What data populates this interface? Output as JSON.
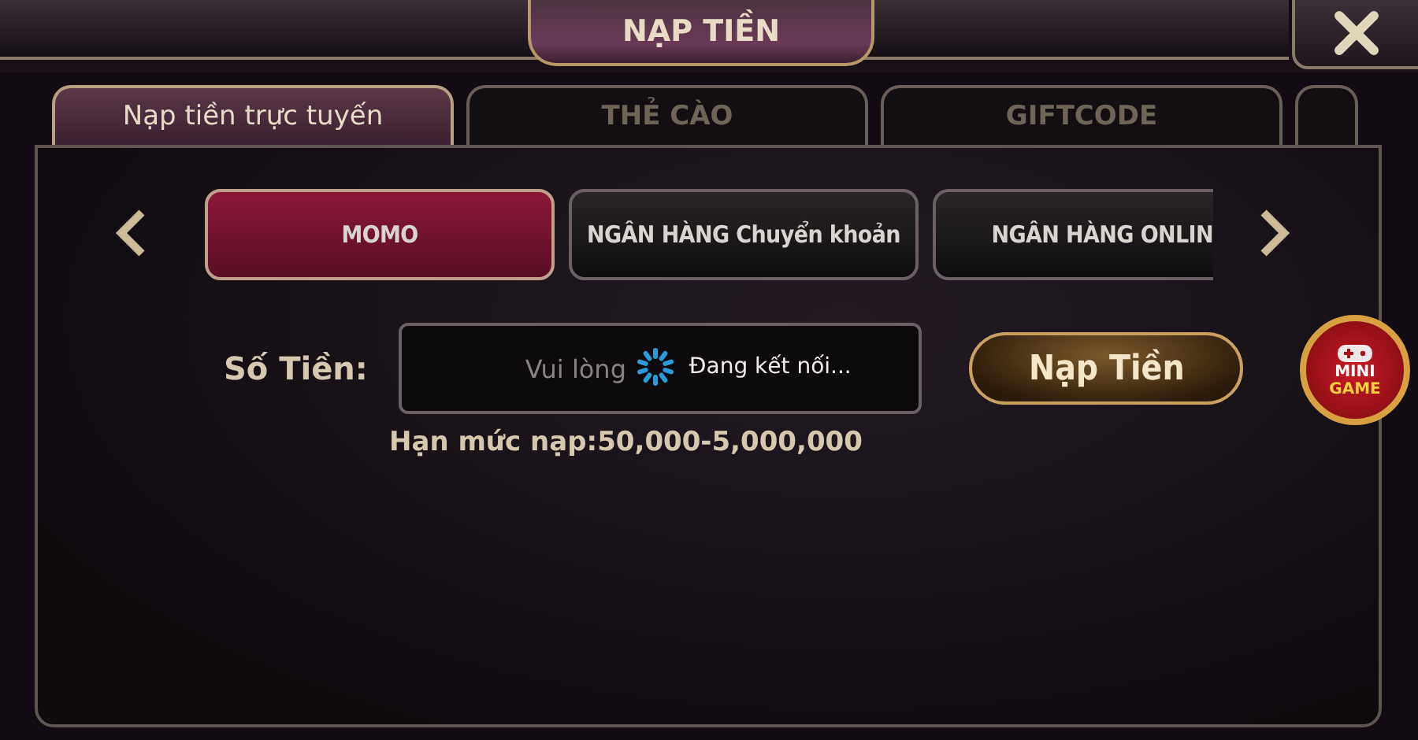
{
  "header": {
    "title": "NẠP TIỀN"
  },
  "tabs": [
    {
      "label": "Nạp tiền trực tuyến",
      "selected": true
    },
    {
      "label": "THẺ CÀO",
      "selected": false
    },
    {
      "label": "GIFTCODE",
      "selected": false
    },
    {
      "selected": false
    }
  ],
  "methods": [
    {
      "label": "MOMO",
      "selected": true
    },
    {
      "label": "NGÂN HÀNG Chuyển khoản",
      "selected": false
    },
    {
      "label": "NGÂN HÀNG ONLIN",
      "selected": false
    }
  ],
  "amount": {
    "label": "Số Tiền:",
    "placeholder": "Vui lòng",
    "loading": "Đang kết nối...",
    "button": "Nạp Tiền",
    "limit": "Hạn mức nạp:50,000-5,000,000"
  },
  "mini_game": {
    "line_1": "MINI",
    "line_2": "GAME"
  }
}
